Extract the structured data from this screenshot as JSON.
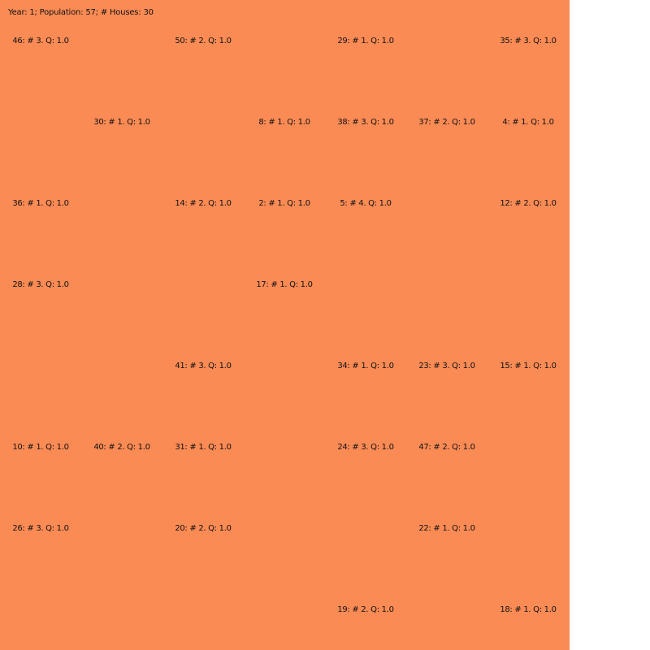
{
  "status_text": "Year: 1; Population: 57; # Houses: 30",
  "colors": {
    "board_background": "#fa8b55",
    "page_background": "#ffffff",
    "text": "#111111"
  },
  "grid": {
    "columns": 7,
    "rows": 8
  },
  "houses": [
    {
      "col": 0,
      "row": 0,
      "label": "46: # 3. Q: 1.0"
    },
    {
      "col": 2,
      "row": 0,
      "label": "50: # 2. Q: 1.0"
    },
    {
      "col": 4,
      "row": 0,
      "label": "29: # 1. Q: 1.0"
    },
    {
      "col": 6,
      "row": 0,
      "label": "35: # 3. Q: 1.0"
    },
    {
      "col": 1,
      "row": 1,
      "label": "30: # 1. Q: 1.0"
    },
    {
      "col": 3,
      "row": 1,
      "label": "8: # 1. Q: 1.0"
    },
    {
      "col": 4,
      "row": 1,
      "label": "38: # 3. Q: 1.0"
    },
    {
      "col": 5,
      "row": 1,
      "label": "37: # 2. Q: 1.0"
    },
    {
      "col": 6,
      "row": 1,
      "label": "4: # 1. Q: 1.0"
    },
    {
      "col": 0,
      "row": 2,
      "label": "36: # 1. Q: 1.0"
    },
    {
      "col": 2,
      "row": 2,
      "label": "14: # 2. Q: 1.0"
    },
    {
      "col": 3,
      "row": 2,
      "label": "2: # 1. Q: 1.0"
    },
    {
      "col": 4,
      "row": 2,
      "label": "5: # 4. Q: 1.0"
    },
    {
      "col": 6,
      "row": 2,
      "label": "12: # 2. Q: 1.0"
    },
    {
      "col": 0,
      "row": 3,
      "label": "28: # 3. Q: 1.0"
    },
    {
      "col": 3,
      "row": 3,
      "label": "17: # 1. Q: 1.0"
    },
    {
      "col": 2,
      "row": 4,
      "label": "41: # 3. Q: 1.0"
    },
    {
      "col": 4,
      "row": 4,
      "label": "34: # 1. Q: 1.0"
    },
    {
      "col": 5,
      "row": 4,
      "label": "23: # 3. Q: 1.0"
    },
    {
      "col": 6,
      "row": 4,
      "label": "15: # 1. Q: 1.0"
    },
    {
      "col": 0,
      "row": 5,
      "label": "10: # 1. Q: 1.0"
    },
    {
      "col": 1,
      "row": 5,
      "label": "40: # 2. Q: 1.0"
    },
    {
      "col": 2,
      "row": 5,
      "label": "31: # 1. Q: 1.0"
    },
    {
      "col": 4,
      "row": 5,
      "label": "24: # 3. Q: 1.0"
    },
    {
      "col": 5,
      "row": 5,
      "label": "47: # 2. Q: 1.0"
    },
    {
      "col": 0,
      "row": 6,
      "label": "26: # 3. Q: 1.0"
    },
    {
      "col": 2,
      "row": 6,
      "label": "20: # 2. Q: 1.0"
    },
    {
      "col": 5,
      "row": 6,
      "label": "22: # 1. Q: 1.0"
    },
    {
      "col": 4,
      "row": 7,
      "label": "19: # 2. Q: 1.0"
    },
    {
      "col": 6,
      "row": 7,
      "label": "18: # 1. Q: 1.0"
    }
  ]
}
